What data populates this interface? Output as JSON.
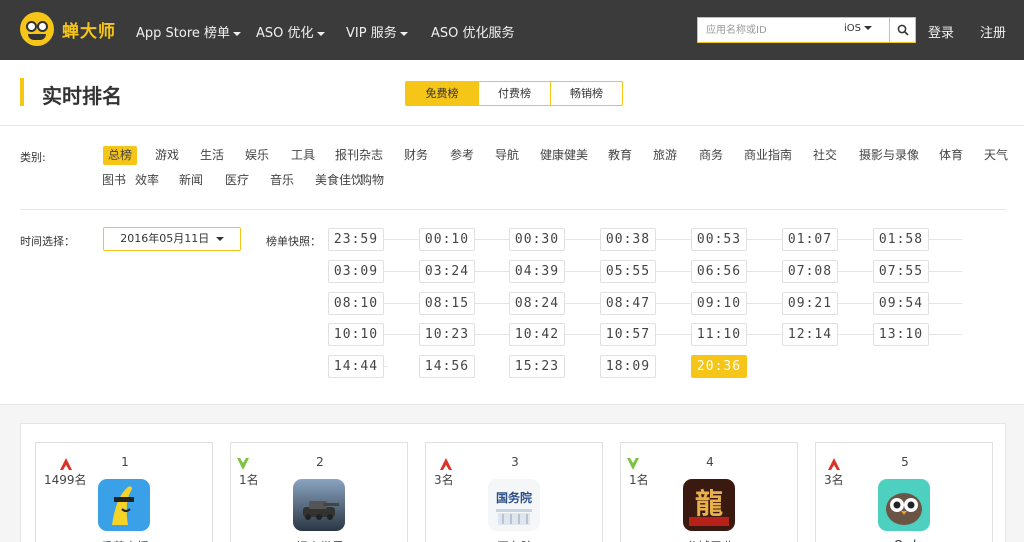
{
  "brand": {
    "name": "蝉大师"
  },
  "nav": [
    {
      "label": "App Store 榜单",
      "has_caret": true
    },
    {
      "label": "ASO 优化",
      "has_caret": true
    },
    {
      "label": "VIP 服务",
      "has_caret": true
    },
    {
      "label": "ASO 优化服务",
      "has_caret": false
    }
  ],
  "search": {
    "placeholder": "应用名称或ID",
    "platform": "iOS"
  },
  "auth": {
    "login": "登录",
    "register": "注册"
  },
  "page": {
    "title": "实时排名"
  },
  "tabs": [
    {
      "label": "免费榜",
      "active": true
    },
    {
      "label": "付费榜",
      "active": false
    },
    {
      "label": "畅销榜",
      "active": false
    }
  ],
  "categories": {
    "label": "类别:",
    "items": [
      "总榜",
      "游戏",
      "生活",
      "娱乐",
      "工具",
      "报刊杂志",
      "财务",
      "参考",
      "导航",
      "健康健美",
      "教育",
      "旅游",
      "商务",
      "商业指南",
      "社交",
      "摄影与录像",
      "体育",
      "天气",
      "图书",
      "效率",
      "新闻",
      "医疗",
      "音乐",
      "美食佳饮",
      "购物"
    ],
    "active": "总榜"
  },
  "time": {
    "label": "时间选择：",
    "date": "2016年05月11日",
    "snapshot_label": "榜单快照：",
    "snapshots": [
      [
        "23:59",
        "00:10",
        "00:30",
        "00:38",
        "00:53",
        "01:07",
        "01:58"
      ],
      [
        "03:09",
        "03:24",
        "04:39",
        "05:55",
        "06:56",
        "07:08",
        "07:55"
      ],
      [
        "08:10",
        "08:15",
        "08:24",
        "08:47",
        "09:10",
        "09:21",
        "09:54"
      ],
      [
        "10:10",
        "10:23",
        "10:42",
        "10:57",
        "11:10",
        "12:14",
        "13:10"
      ],
      [
        "14:44",
        "14:56",
        "15:23",
        "18:09",
        "20:36"
      ]
    ],
    "active": "20:36"
  },
  "apps": [
    {
      "rank": "1",
      "trend": "up",
      "change": "1499名",
      "name": "香蕉直播"
    },
    {
      "rank": "2",
      "trend": "down",
      "change": "1名",
      "name": "坦克世界"
    },
    {
      "rank": "3",
      "trend": "up",
      "change": "3名",
      "name": "国务院"
    },
    {
      "rank": "4",
      "trend": "down",
      "change": "1名",
      "name": "龙城霸业"
    },
    {
      "rank": "5",
      "trend": "up",
      "change": "3名",
      "name": "Owl"
    }
  ],
  "icon_texts": {
    "gov_icon": "国务院"
  },
  "colors": {
    "accent": "#f5c518",
    "topbar": "#3b3b3b",
    "up": "#d9332a",
    "down": "#7cc243"
  }
}
